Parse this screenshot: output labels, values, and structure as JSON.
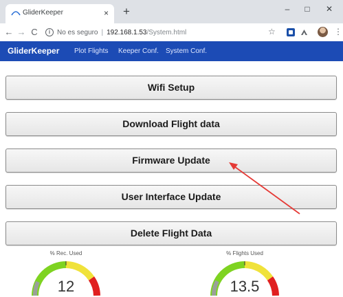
{
  "browser": {
    "tab_title": "GliderKeeper",
    "tab_close": "×",
    "new_tab": "+",
    "window_minimize": "–",
    "window_maximize": "□",
    "window_close": "✕",
    "nav_back": "←",
    "nav_forward": "→",
    "nav_reload": "C",
    "security_text": "No es seguro",
    "separator": "|",
    "url_host": "192.168.1.53",
    "url_path": "/System.html",
    "star": "☆",
    "menu": "⋮"
  },
  "navbar": {
    "brand": "GliderKeeper",
    "links": [
      "Plot Flights",
      "Keeper Conf.",
      "System Conf."
    ],
    "color": "#1c4bb5"
  },
  "actions": [
    "Wifi Setup",
    "Download Flight data",
    "Firmware Update",
    "User Interface Update",
    "Delete Flight Data"
  ],
  "gauges": [
    {
      "label": "% Rec. Used",
      "value": "12"
    },
    {
      "label": "% Flights Used",
      "value": "13.5"
    }
  ],
  "colors": {
    "gauge_green": "#7ed321",
    "gauge_yellow": "#f0e23a",
    "gauge_red": "#e02020",
    "gauge_fill": "#9aa09a",
    "arrow": "#e53935"
  }
}
